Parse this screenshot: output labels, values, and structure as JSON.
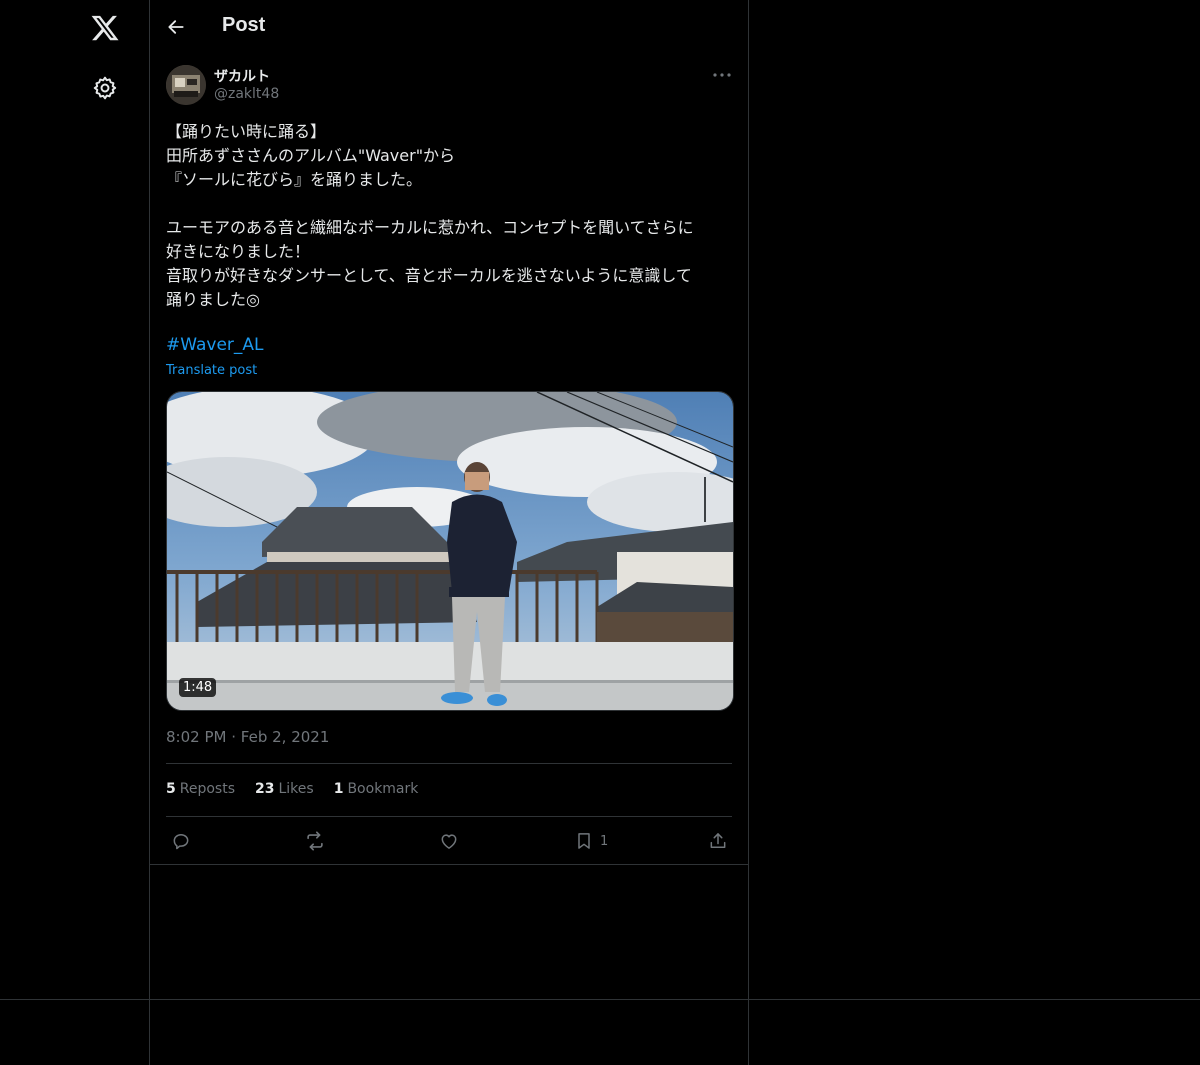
{
  "header": {
    "title": "Post"
  },
  "post": {
    "author": {
      "display_name": "ザカルト",
      "handle": "@zaklt48"
    },
    "text": "【踊りたい時に踊る】\n田所あずささんのアルバム\"Waver\"から\n『ソールに花びら』を踊りました。\n\nユーモアのある音と繊細なボーカルに惹かれ、コンセプトを聞いてさらに\n好きになりました！\n音取りが好きなダンサーとして、音とボーカルを逃さないように意識して\n踊りました◎",
    "hashtag": "#Waver_AL",
    "translate_label": "Translate post",
    "media": {
      "duration": "1:48"
    },
    "time": "8:02 PM",
    "date": "Feb 2, 2021",
    "separator": "·"
  },
  "stats": {
    "reposts_count": "5",
    "reposts_label": "Reposts",
    "likes_count": "23",
    "likes_label": "Likes",
    "bookmarks_count": "1",
    "bookmarks_label": "Bookmark"
  },
  "actions": {
    "bookmark_count": "1"
  },
  "colors": {
    "background": "#000000",
    "border": "#2f3336",
    "text": "#e7e9ea",
    "muted": "#71767b",
    "link": "#1d9bf0"
  }
}
